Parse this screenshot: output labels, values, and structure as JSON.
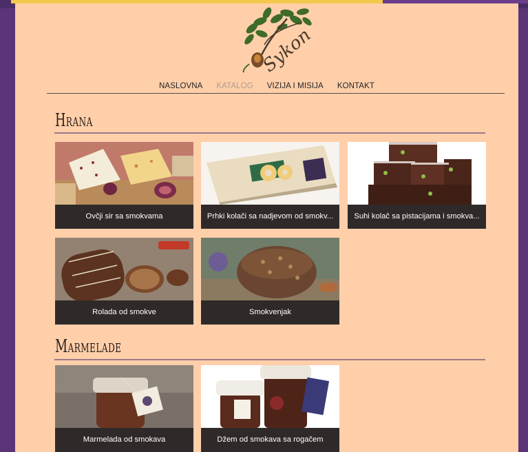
{
  "brand": {
    "logo_text": "Sykon"
  },
  "nav": {
    "items": [
      {
        "label": "NASLOVNA"
      },
      {
        "label": "KATALOG"
      },
      {
        "label": "VIZIJA I MISIJA"
      },
      {
        "label": "KONTAKT"
      }
    ],
    "active_index": 1
  },
  "sections": [
    {
      "title": "Hrana",
      "products": [
        {
          "name": "Ovčji sir sa smokvama"
        },
        {
          "name": "Prhki kolači sa nadjevom od smokv..."
        },
        {
          "name": "Suhi kolač sa pistacijama i smokva..."
        },
        {
          "name": "Rolada od smokve"
        },
        {
          "name": "Smokvenjak"
        }
      ]
    },
    {
      "title": "Marmelade",
      "products": [
        {
          "name": "Marmelada od smokava"
        },
        {
          "name": "Džem od smokava sa rogačem"
        }
      ]
    }
  ],
  "colors": {
    "page_bg": "#ffcfaa",
    "frame": "#5b3577",
    "caption_bg": "#2f2a29",
    "nav_active": "#b1998a",
    "section_rule": "#9c7a88"
  }
}
